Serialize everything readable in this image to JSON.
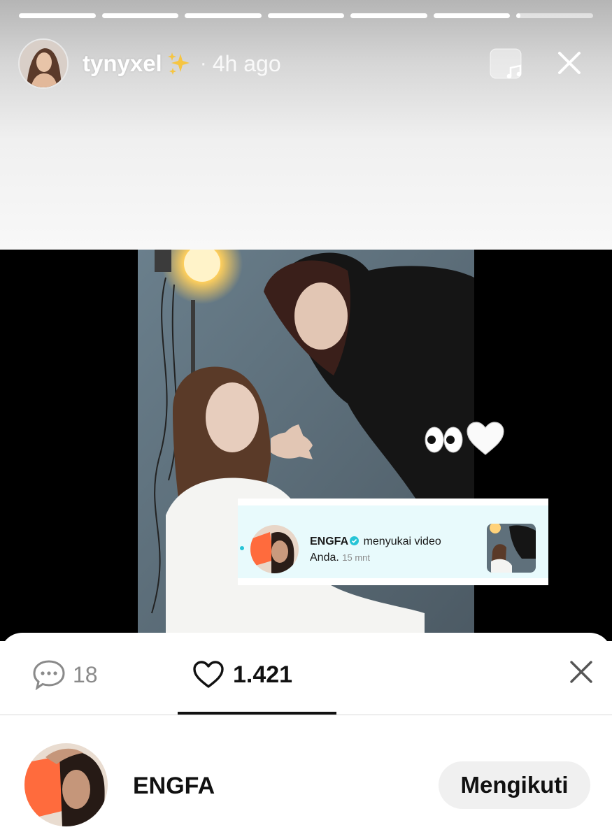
{
  "story": {
    "progress": [
      1,
      1,
      1,
      1,
      1,
      1,
      0.05
    ],
    "username": "tynyxel",
    "separator": "·",
    "time_ago": "4h ago",
    "icons": {
      "sparkle": "sparkles-emoji",
      "music": "music-icon",
      "close": "close-icon"
    }
  },
  "video": {
    "stickers": [
      "eyes-emoji",
      "white-heart-emoji"
    ],
    "notification": {
      "name": "ENGFA",
      "action": "menyukai video",
      "line2": "Anda.",
      "time": "15 mnt"
    }
  },
  "sheet": {
    "comments_count": "18",
    "likes_count": "1.421",
    "user": {
      "name": "ENGFA",
      "follow_label": "Mengikuti"
    }
  },
  "colors": {
    "accent_cyan": "#27c4d6",
    "notif_bg": "#e8fafc",
    "follow_bg": "#f0f0f0"
  }
}
